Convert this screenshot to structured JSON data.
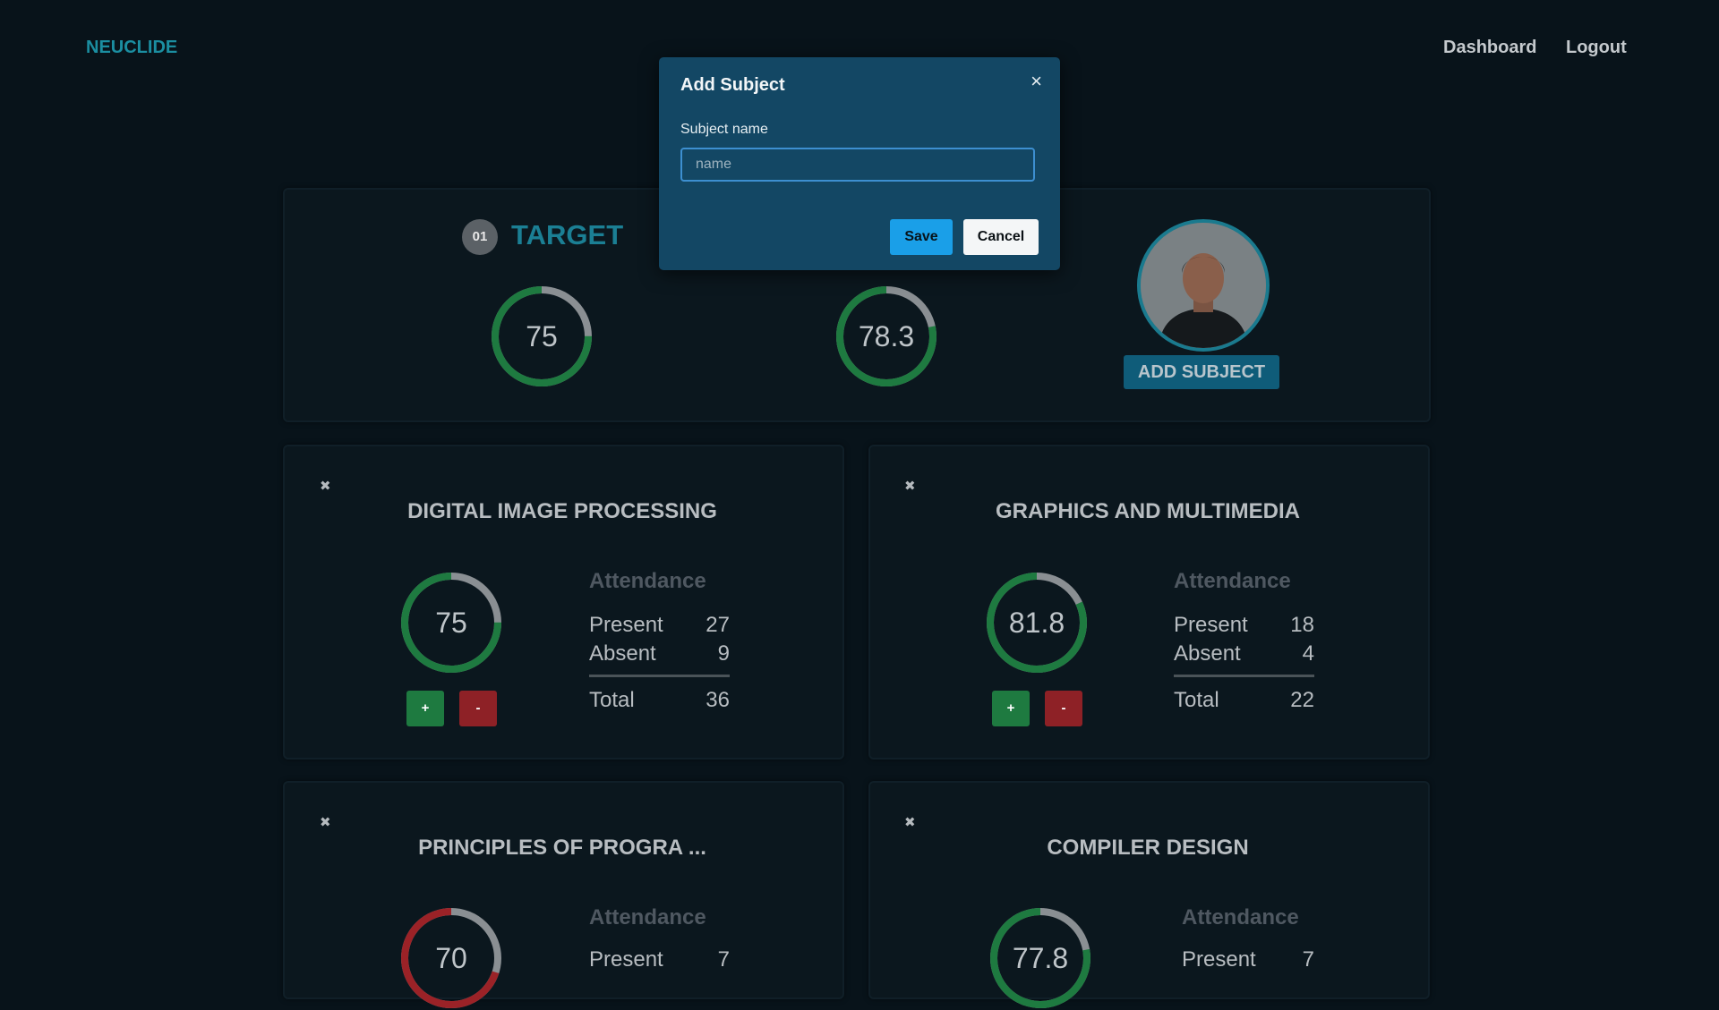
{
  "nav": {
    "brand": "NEUCLIDE",
    "links": [
      "Dashboard",
      "Logout"
    ]
  },
  "summary": {
    "step": "01",
    "title": "TARGET",
    "target_value": 75,
    "overall_value": 78.3,
    "add_subject_label": "ADD SUBJECT"
  },
  "subjects": [
    {
      "name": "DIGITAL IMAGE PROCESSING",
      "percent": 75,
      "heading": "Attendance",
      "present_label": "Present",
      "present": 27,
      "absent_label": "Absent",
      "absent": 9,
      "total_label": "Total",
      "total": 36,
      "plus": "+",
      "minus": "-"
    },
    {
      "name": "GRAPHICS AND MULTIMEDIA",
      "percent": 81.8,
      "heading": "Attendance",
      "present_label": "Present",
      "present": 18,
      "absent_label": "Absent",
      "absent": 4,
      "total_label": "Total",
      "total": 22,
      "plus": "+",
      "minus": "-"
    },
    {
      "name": "PRINCIPLES OF PROGRA ...",
      "percent": 70,
      "heading": "Attendance",
      "present_label": "Present",
      "present": 7
    },
    {
      "name": "COMPILER DESIGN",
      "percent": 77.8,
      "heading": "Attendance",
      "present_label": "Present",
      "present": 7
    }
  ],
  "modal": {
    "title": "Add Subject",
    "field_label": "Subject name",
    "placeholder": "name",
    "save_label": "Save",
    "cancel_label": "Cancel",
    "close_glyph": "×"
  },
  "card_close_glyph": "✖",
  "colors": {
    "good": "#1e7a40",
    "bad": "#9b2227",
    "track": "#8a8f93",
    "accent": "#1b8ea1"
  }
}
